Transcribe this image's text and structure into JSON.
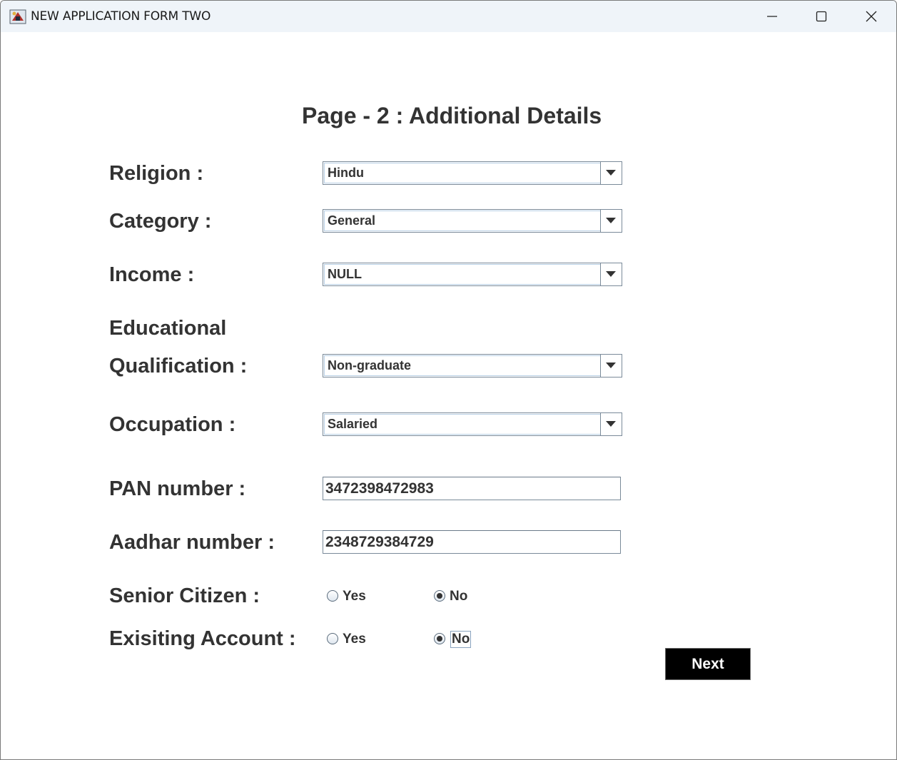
{
  "window": {
    "title": "NEW APPLICATION FORM TWO",
    "icon": "java-app-icon",
    "controls": [
      "minimize-icon",
      "maximize-icon",
      "close-icon"
    ]
  },
  "form": {
    "heading": "Page - 2 : Additional Details",
    "religion": {
      "label": "Religion :",
      "value": "Hindu"
    },
    "category": {
      "label": "Category :",
      "value": "General"
    },
    "income": {
      "label": "Income :",
      "value": "NULL"
    },
    "education": {
      "label_line1": "Educational",
      "label_line2": "Qualification :",
      "value": "Non-graduate"
    },
    "occupation": {
      "label": "Occupation :",
      "value": "Salaried"
    },
    "pan": {
      "label": "PAN number :",
      "value": "3472398472983"
    },
    "aadhar": {
      "label": "Aadhar number :",
      "value": "2348729384729"
    },
    "senior_citizen": {
      "label": "Senior Citizen :",
      "yes": "Yes",
      "no": "No",
      "selected": "No"
    },
    "existing_account": {
      "label": "Exisiting Account :",
      "yes": "Yes",
      "no": "No",
      "selected": "No"
    },
    "next_button": "Next"
  },
  "colors": {
    "titlebar": "#eff4f9",
    "text": "#333333",
    "button_bg": "#000000",
    "button_text": "#ffffff"
  }
}
